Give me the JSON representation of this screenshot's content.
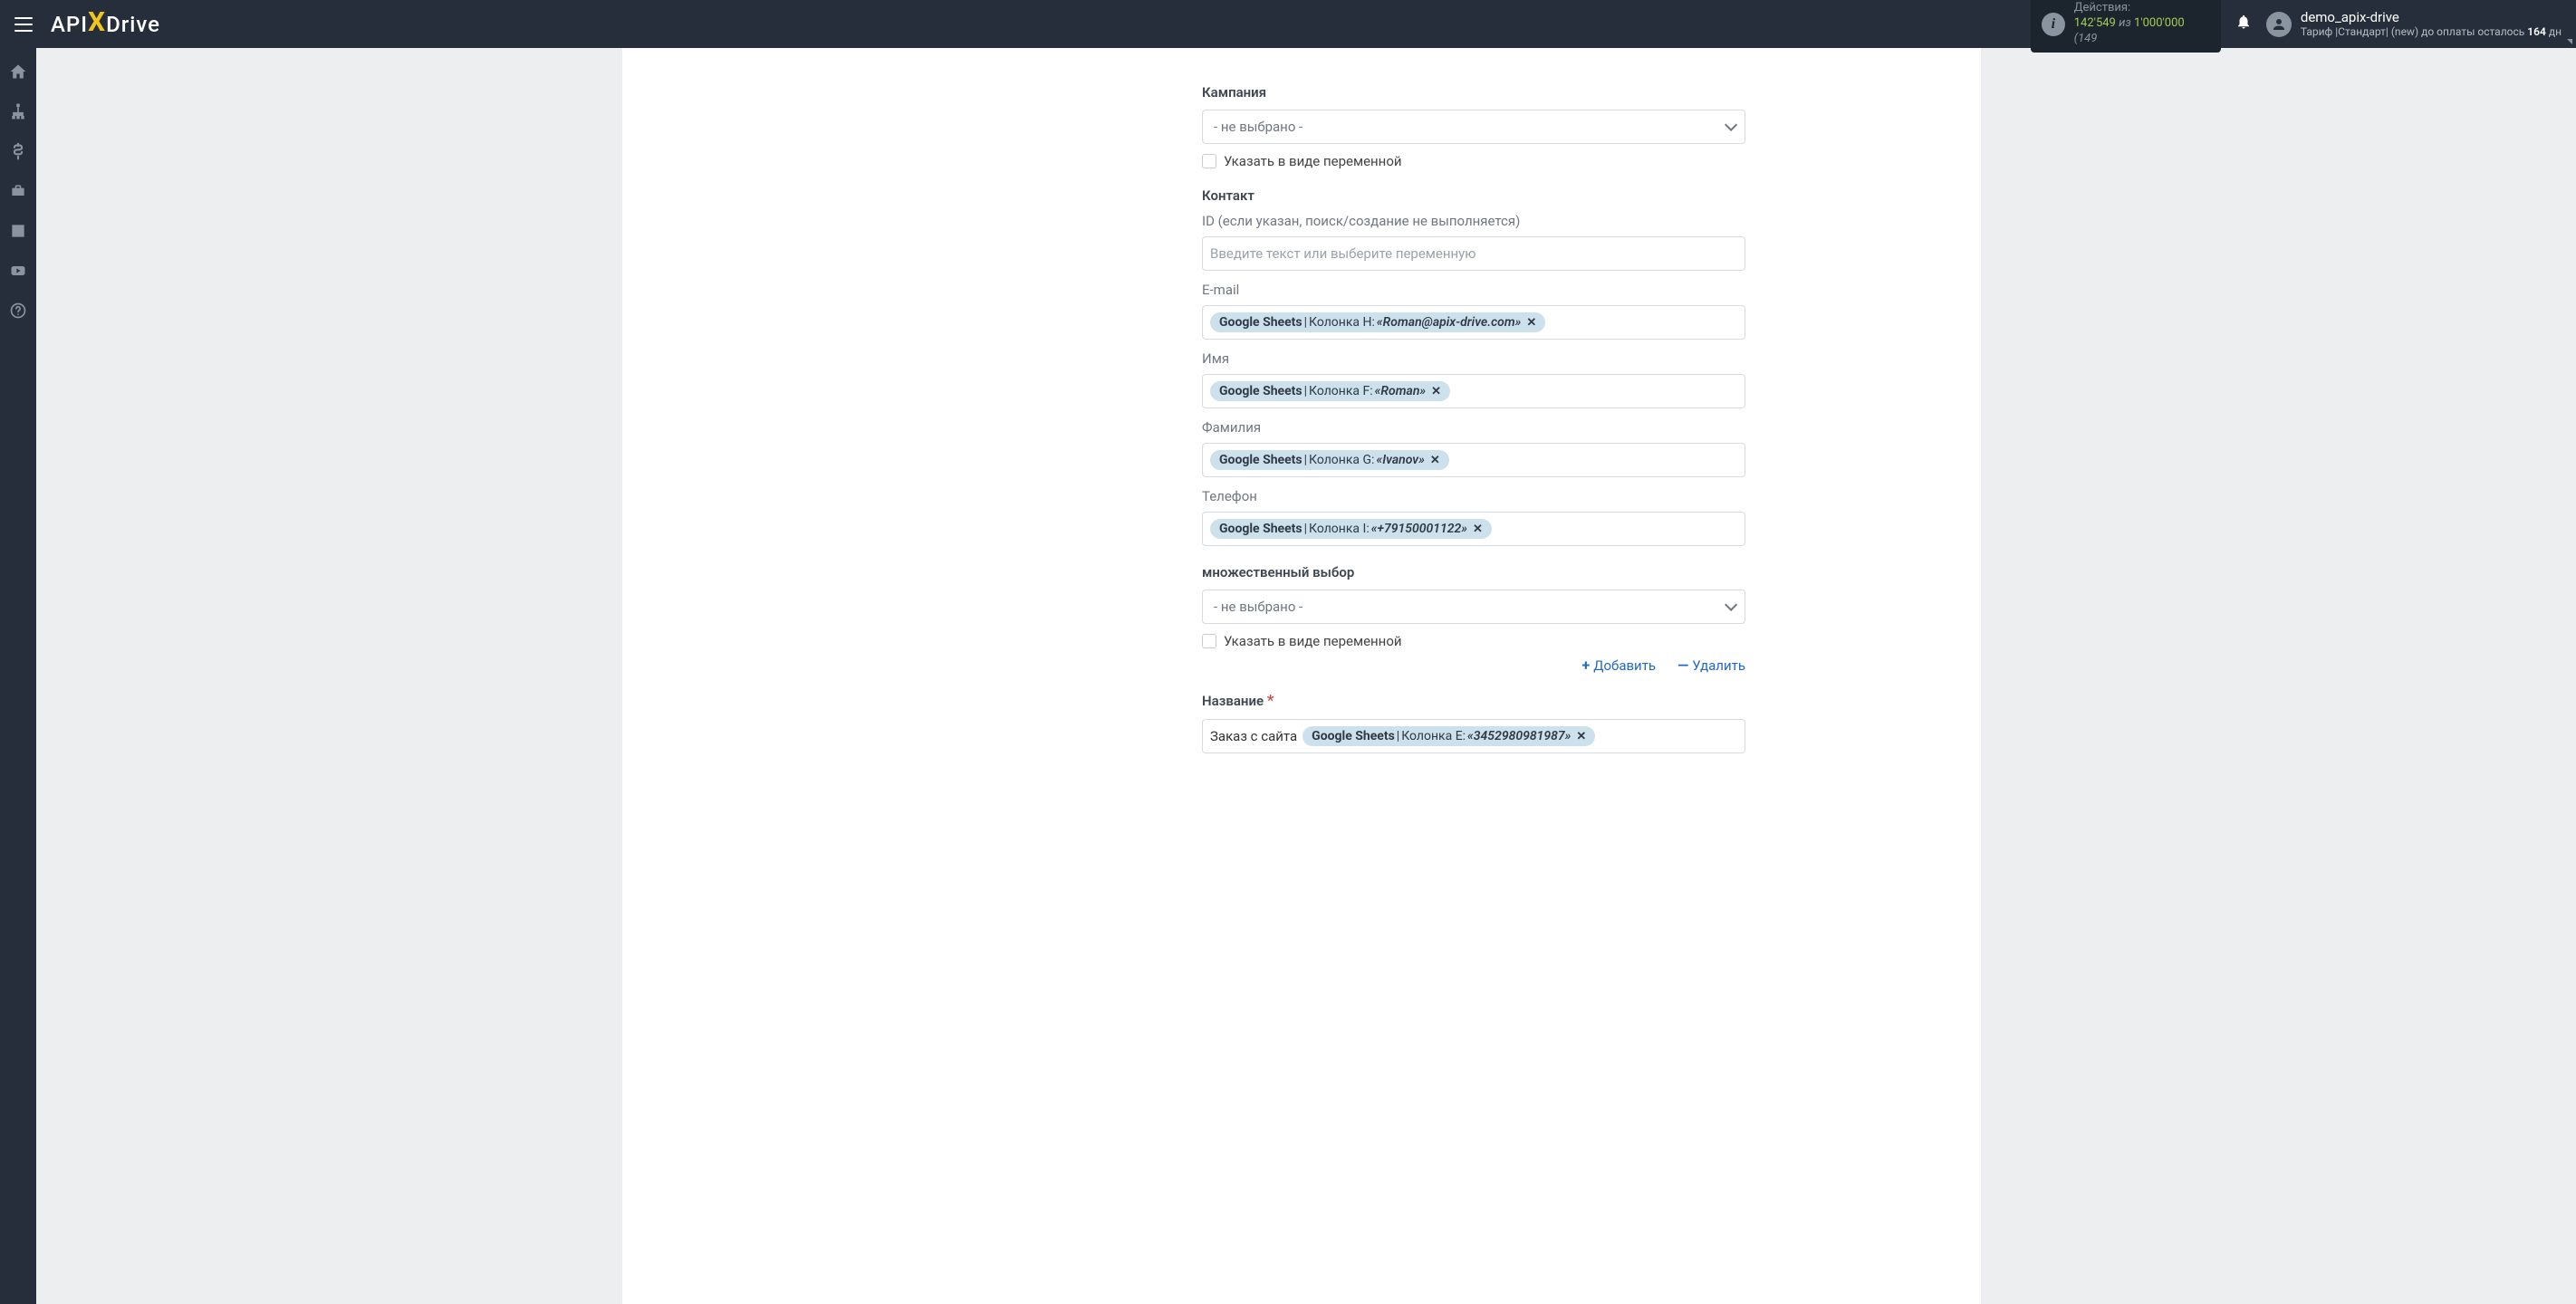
{
  "header": {
    "logo": {
      "api": "API",
      "x": "X",
      "drive": "Drive"
    },
    "actions": {
      "label": "Действия:",
      "current": "142'549",
      "iz": "из",
      "total": "1'000'000",
      "tail": "(149"
    },
    "user": {
      "name": "demo_apix-drive",
      "tariff_prefix": "Тариф |",
      "tariff_name": "Стандарт",
      "tariff_mid": "| (new) до оплаты осталось",
      "days": "164",
      "days_suffix": "дн"
    }
  },
  "form": {
    "campaign": {
      "label": "Кампания",
      "placeholder": "- не выбрано -",
      "checkbox": "Указать в виде переменной"
    },
    "contact": {
      "label": "Контакт",
      "id_label": "ID (если указан, поиск/создание не выполняется)",
      "id_placeholder": "Введите текст или выберите переменную",
      "email": {
        "label": "E-mail",
        "tag_source": "Google Sheets",
        "tag_sep": " | ",
        "tag_col": "Колонка H: ",
        "tag_val": "«Roman@apix-drive.com»"
      },
      "name": {
        "label": "Имя",
        "tag_source": "Google Sheets",
        "tag_sep": " | ",
        "tag_col": "Колонка F: ",
        "tag_val": "«Roman»"
      },
      "surname": {
        "label": "Фамилия",
        "tag_source": "Google Sheets",
        "tag_sep": " | ",
        "tag_col": "Колонка G: ",
        "tag_val": "«Ivanov»"
      },
      "phone": {
        "label": "Телефон",
        "tag_source": "Google Sheets",
        "tag_sep": " | ",
        "tag_col": "Колонка I: ",
        "tag_val": "«+79150001122»"
      }
    },
    "multi": {
      "label": "множественный выбор",
      "placeholder": "- не выбрано -",
      "checkbox": "Указать в виде переменной"
    },
    "actions": {
      "add": "Добавить",
      "remove": "Удалить"
    },
    "title_field": {
      "label": "Название",
      "prefix": "Заказ с сайта",
      "tag_source": "Google Sheets",
      "tag_sep": " | ",
      "tag_col": "Колонка E: ",
      "tag_val": "«3452980981987»"
    }
  }
}
